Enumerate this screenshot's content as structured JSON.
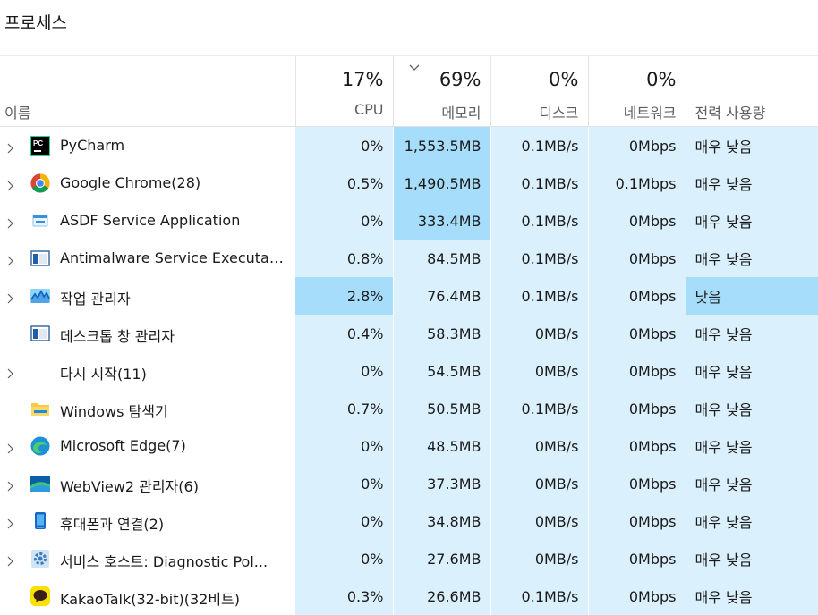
{
  "window": {
    "title": "프로세스"
  },
  "header": {
    "name_label": "이름",
    "cpu": {
      "pct": "17%",
      "label": "CPU"
    },
    "memory": {
      "pct": "69%",
      "label": "메모리"
    },
    "disk": {
      "pct": "0%",
      "label": "디스크"
    },
    "network": {
      "pct": "0%",
      "label": "네트워크"
    },
    "power": {
      "label": "전력 사용량"
    }
  },
  "colors": {
    "column_tint": "#dbf0fd",
    "highlight": "#a6ddfb"
  },
  "processes": [
    {
      "name": "PyCharm",
      "icon": "pycharm-icon",
      "expandable": true,
      "cpu": "0%",
      "memory": "1,553.5MB",
      "disk": "0.1MB/s",
      "network": "0Mbps",
      "power": "매우 낮음"
    },
    {
      "name": "Google Chrome(28)",
      "icon": "chrome-icon",
      "expandable": true,
      "cpu": "0.5%",
      "memory": "1,490.5MB",
      "disk": "0.1MB/s",
      "network": "0.1Mbps",
      "power": "매우 낮음"
    },
    {
      "name": "ASDF Service Application",
      "icon": "asdf-service-icon",
      "expandable": true,
      "cpu": "0%",
      "memory": "333.4MB",
      "disk": "0.1MB/s",
      "network": "0Mbps",
      "power": "매우 낮음"
    },
    {
      "name": "Antimalware Service Executab...",
      "icon": "antimalware-icon",
      "expandable": true,
      "cpu": "0.8%",
      "memory": "84.5MB",
      "disk": "0.1MB/s",
      "network": "0Mbps",
      "power": "매우 낮음"
    },
    {
      "name": "작업 관리자",
      "icon": "task-manager-icon",
      "expandable": true,
      "cpu": "2.8%",
      "memory": "76.4MB",
      "disk": "0.1MB/s",
      "network": "0Mbps",
      "power": "낮음"
    },
    {
      "name": "데스크톱 창 관리자",
      "icon": "desktop-window-manager-icon",
      "expandable": false,
      "cpu": "0.4%",
      "memory": "58.3MB",
      "disk": "0MB/s",
      "network": "0Mbps",
      "power": "매우 낮음"
    },
    {
      "name": "다시 시작(11)",
      "icon": "",
      "expandable": true,
      "cpu": "0%",
      "memory": "54.5MB",
      "disk": "0MB/s",
      "network": "0Mbps",
      "power": "매우 낮음"
    },
    {
      "name": "Windows 탐색기",
      "icon": "file-explorer-icon",
      "expandable": false,
      "cpu": "0.7%",
      "memory": "50.5MB",
      "disk": "0.1MB/s",
      "network": "0Mbps",
      "power": "매우 낮음"
    },
    {
      "name": "Microsoft Edge(7)",
      "icon": "edge-icon",
      "expandable": true,
      "cpu": "0%",
      "memory": "48.5MB",
      "disk": "0MB/s",
      "network": "0Mbps",
      "power": "매우 낮음"
    },
    {
      "name": "WebView2 관리자(6)",
      "icon": "webview2-icon",
      "expandable": true,
      "cpu": "0%",
      "memory": "37.3MB",
      "disk": "0MB/s",
      "network": "0Mbps",
      "power": "매우 낮음"
    },
    {
      "name": "휴대폰과 연결(2)",
      "icon": "phone-link-icon",
      "expandable": true,
      "cpu": "0%",
      "memory": "34.8MB",
      "disk": "0MB/s",
      "network": "0Mbps",
      "power": "매우 낮음"
    },
    {
      "name": "서비스 호스트: Diagnostic Pol...",
      "icon": "service-host-icon",
      "expandable": true,
      "cpu": "0%",
      "memory": "27.6MB",
      "disk": "0MB/s",
      "network": "0Mbps",
      "power": "매우 낮음"
    },
    {
      "name": "KakaoTalk(32-bit)(32비트)",
      "icon": "kakaotalk-icon",
      "expandable": false,
      "cpu": "0.3%",
      "memory": "26.6MB",
      "disk": "0.1MB/s",
      "network": "0Mbps",
      "power": "매우 낮음"
    }
  ]
}
